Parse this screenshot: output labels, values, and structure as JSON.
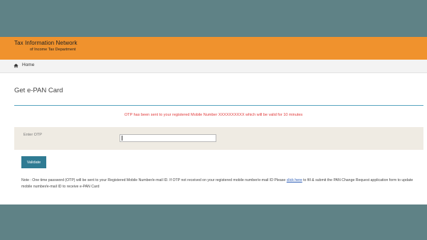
{
  "header": {
    "brand_title": "Tax Information Network",
    "brand_subtitle": "of Income Tax Department"
  },
  "nav": {
    "home_icon": "home-icon",
    "home_label": "Home"
  },
  "main": {
    "title": "Get e-PAN Card",
    "otp_message": "OTP has been sent to your registered Mobile Number XXXXXXXXXX which will be valid for 10 minutes",
    "otp_label": "Enter OTP",
    "otp_value": "",
    "validate_label": "Validate",
    "note_before_link": "Note : One time password (OTP) will be sent to your Registered Mobile Number/e-mail ID. If OTP not received on your registered mobile number/e-mail ID  Please ",
    "note_link": "click here",
    "note_after_link": " to fill & submit the PAN Change Request application form to update mobile number/e-mail ID to receive e-PAN Card"
  },
  "colors": {
    "header_bg": "#f0922d",
    "accent": "#2f7b93",
    "error_text": "#e03a3a",
    "outer_bg": "#5f8286"
  }
}
